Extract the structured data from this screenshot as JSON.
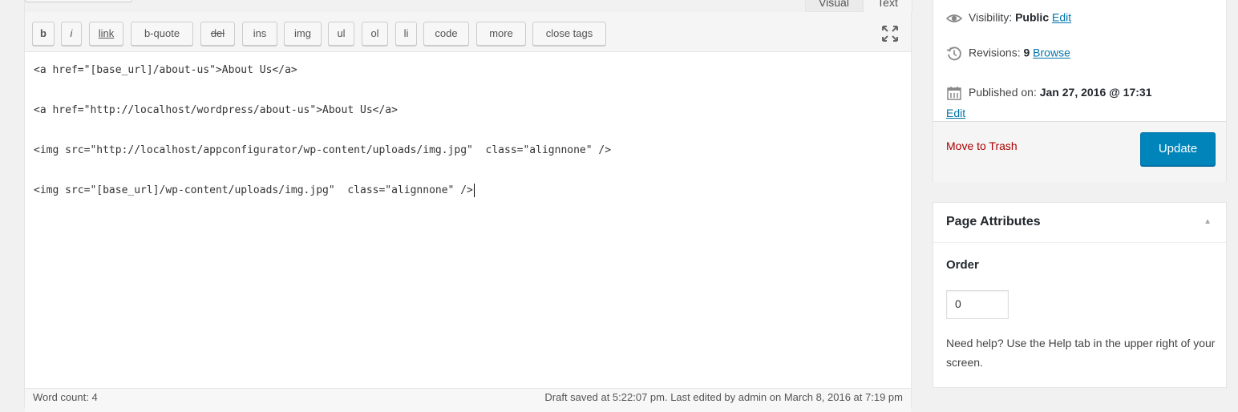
{
  "editor": {
    "mode_tabs": [
      "Visual",
      "Text"
    ],
    "toolbar_buttons": [
      "b",
      "i",
      "link",
      "b-quote",
      "del",
      "ins",
      "img",
      "ul",
      "ol",
      "li",
      "code",
      "more",
      "close tags"
    ],
    "code_lines": [
      "<a href=\"[base_url]/about-us\">About Us</a>",
      "<a href=\"http://localhost/wordpress/about-us\">About Us</a>",
      "<img src=\"http://localhost/appconfigurator/wp-content/uploads/img.jpg\"  class=\"alignnone\" />",
      "<img src=\"[base_url]/wp-content/uploads/img.jpg\"  class=\"alignnone\" />"
    ],
    "word_count": "Word count: 4",
    "status_text": "Draft saved at 5:22:07 pm. Last edited by admin on March 8, 2016 at 7:19 pm"
  },
  "publish": {
    "visibility_label": "Visibility:",
    "visibility_value": "Public",
    "visibility_edit": "Edit",
    "revisions_label": "Revisions:",
    "revisions_value": "9",
    "revisions_browse": "Browse",
    "published_label": "Published on:",
    "published_value": "Jan 27, 2016 @ 17:31",
    "published_edit": "Edit",
    "trash_label": "Move to Trash",
    "update_label": "Update"
  },
  "page_attributes": {
    "title": "Page Attributes",
    "order_label": "Order",
    "order_value": "0",
    "help_text": "Need help? Use the Help tab in the upper right of your screen."
  },
  "colors": {
    "primary_button": "#0085ba",
    "link": "#0073aa",
    "trash": "#a00000"
  },
  "icons": [
    "visibility-eye-icon",
    "revisions-clock-icon",
    "calendar-icon",
    "fullscreen-icon",
    "collapse-arrow-icon"
  ]
}
